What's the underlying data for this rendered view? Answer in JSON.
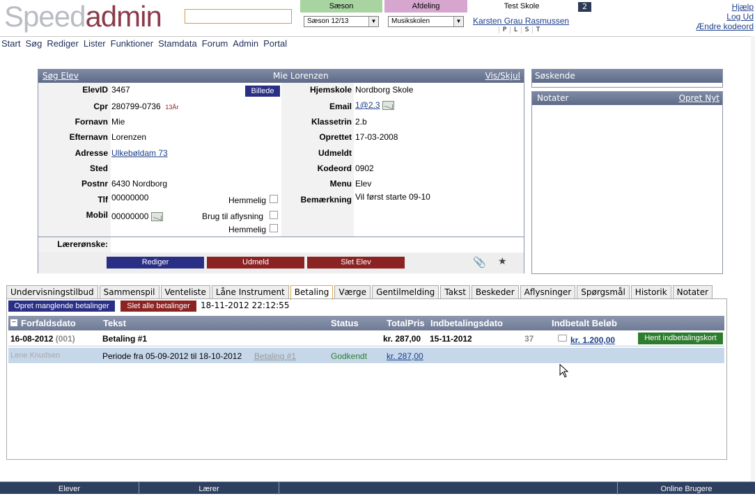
{
  "header": {
    "logo_speed": "Speed",
    "logo_admin": "admin",
    "tab_saeson": "Sæson",
    "tab_afdeling": "Afdeling",
    "tab_testskole": "Test Skole",
    "badge": "2",
    "saeson_select": "Sæson 12/13",
    "afdeling_select": "Musikskolen",
    "user_name": "Karsten Grau Rasmussen",
    "plst": [
      "P",
      "L",
      "S",
      "T"
    ],
    "help": "Hjælp",
    "logout": "Log Ud",
    "change_password": "Ændre kodeord"
  },
  "menu": [
    "Start",
    "Søg",
    "Rediger",
    "Lister",
    "Funktioner",
    "Stamdata",
    "Forum",
    "Admin",
    "Portal"
  ],
  "student": {
    "search_link": "Søg Elev",
    "name": "Mie Lorenzen",
    "toggle_link": "Vis/Skjul",
    "picture_button": "Billede",
    "fields_left": {
      "elevid_label": "ElevID",
      "elevid": "3467",
      "cpr_label": "Cpr",
      "cpr": "280799-0736",
      "age": "13År",
      "fornavn_label": "Fornavn",
      "fornavn": "Mie",
      "efternavn_label": "Efternavn",
      "efternavn": "Lorenzen",
      "adresse_label": "Adresse",
      "adresse": "Ulkebøldam 73",
      "sted_label": "Sted",
      "postnr_label": "Postnr",
      "postnr": "6430 Nordborg",
      "tlf_label": "Tlf",
      "tlf": "00000000",
      "mobil_label": "Mobil",
      "mobil": "00000000",
      "hemmelig1": "Hemmelig",
      "aflysning": "Brug til aflysning",
      "hemmelig2": "Hemmelig"
    },
    "fields_right": {
      "hjemskole_label": "Hjemskole",
      "hjemskole": "Nordborg Skole",
      "email_label": "Email",
      "email": "1@2.3",
      "klassetrin_label": "Klassetrin",
      "klassetrin": "2.b",
      "oprettet_label": "Oprettet",
      "oprettet": "17-03-2008",
      "udmeldt_label": "Udmeldt",
      "kodeord_label": "Kodeord",
      "kodeord": "0902",
      "menu_label": "Menu",
      "menu": "Elev",
      "bemaerkning_label": "Bemærkning",
      "bemaerkning": "Vil først starte 09-10"
    },
    "laereronske_label": "Lærerønske:",
    "buttons": {
      "rediger": "Rediger",
      "udmeld": "Udmeld",
      "slet": "Slet Elev"
    }
  },
  "side": {
    "soskende": "Søskende",
    "notater": "Notater",
    "opret_nyt": "Opret Nyt"
  },
  "tabs": [
    "Undervisningstilbud",
    "Sammenspil",
    "Venteliste",
    "Låne Instrument",
    "Betaling",
    "Værge",
    "Gentilmelding",
    "Takst",
    "Beskeder",
    "Aflysninger",
    "Spørgsmål",
    "Historik",
    "Notater"
  ],
  "active_tab": "Betaling",
  "payments": {
    "btn_create_missing": "Opret manglende betalinger",
    "btn_delete_all": "Slet alle betalinger",
    "timestamp": "18-11-2012 22:12:55",
    "columns": [
      "Forfaldsdato",
      "Tekst",
      "Status",
      "TotalPris",
      "Indbetalingsdato",
      "Indbetalt Beløb"
    ],
    "row1": {
      "date": "16-08-2012",
      "num": "(001)",
      "text": "Betaling #1",
      "total": "kr. 287,00",
      "paydate": "15-11-2012",
      "count": "37",
      "paid": "kr. 1.200,00",
      "button": "Hent indbetalingskort"
    },
    "row2": {
      "name": "Lene Knudsen",
      "period": "Periode fra 05-09-2012 til 18-10-2012",
      "ref": "Betaling #1",
      "status": "Godkendt",
      "amount": "kr. 287,00"
    }
  },
  "footer": {
    "elever": "Elever",
    "laerer": "Lærer",
    "online": "Online Brugere"
  },
  "colors": {
    "saeson_tab": "#a8d4a1",
    "afdeling_tab": "#d7a6cf",
    "nav_blue": "#2a2f86",
    "danger_red": "#8b2323",
    "success_green": "#2e7d2e"
  }
}
